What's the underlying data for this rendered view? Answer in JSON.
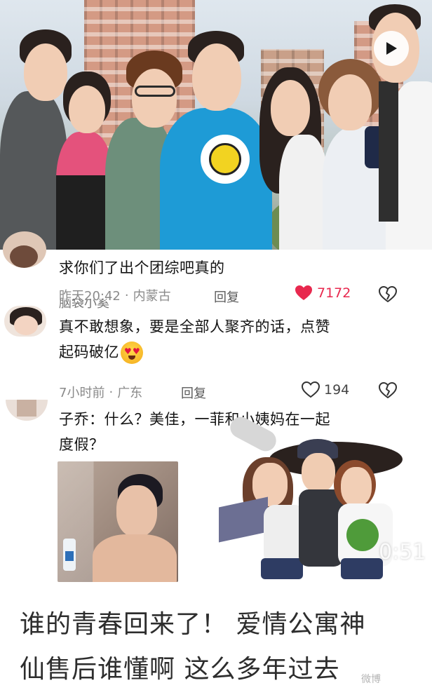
{
  "video": {
    "play_icon": "play-icon",
    "timer": "0:51"
  },
  "comments": [
    {
      "text": "求你们了出个团综吧真的",
      "time": "昨天20:42",
      "location": "内蒙古",
      "reply_label": "回复",
      "likes": "7172",
      "liked": true,
      "like_color": "#e8284e"
    },
    {
      "username_partial": "脑袋小奚",
      "text_line1": "真不敢想象，要是全部人聚齐的话，点赞",
      "text_line2": "起码破亿",
      "emoji": "heart-eyes-emoji",
      "time": "7小时前",
      "location": "广东",
      "reply_label": "回复",
      "likes": "194",
      "liked": false
    },
    {
      "text_line1": "子乔：什么？美佳，一菲和小姨妈在一起",
      "text_line2": "度假？"
    }
  ],
  "caption": {
    "line1": "谁的青春回来了！ 爱情公寓神",
    "line2": "仙售后谁懂啊 这么多年过去"
  },
  "watermark": "微博"
}
